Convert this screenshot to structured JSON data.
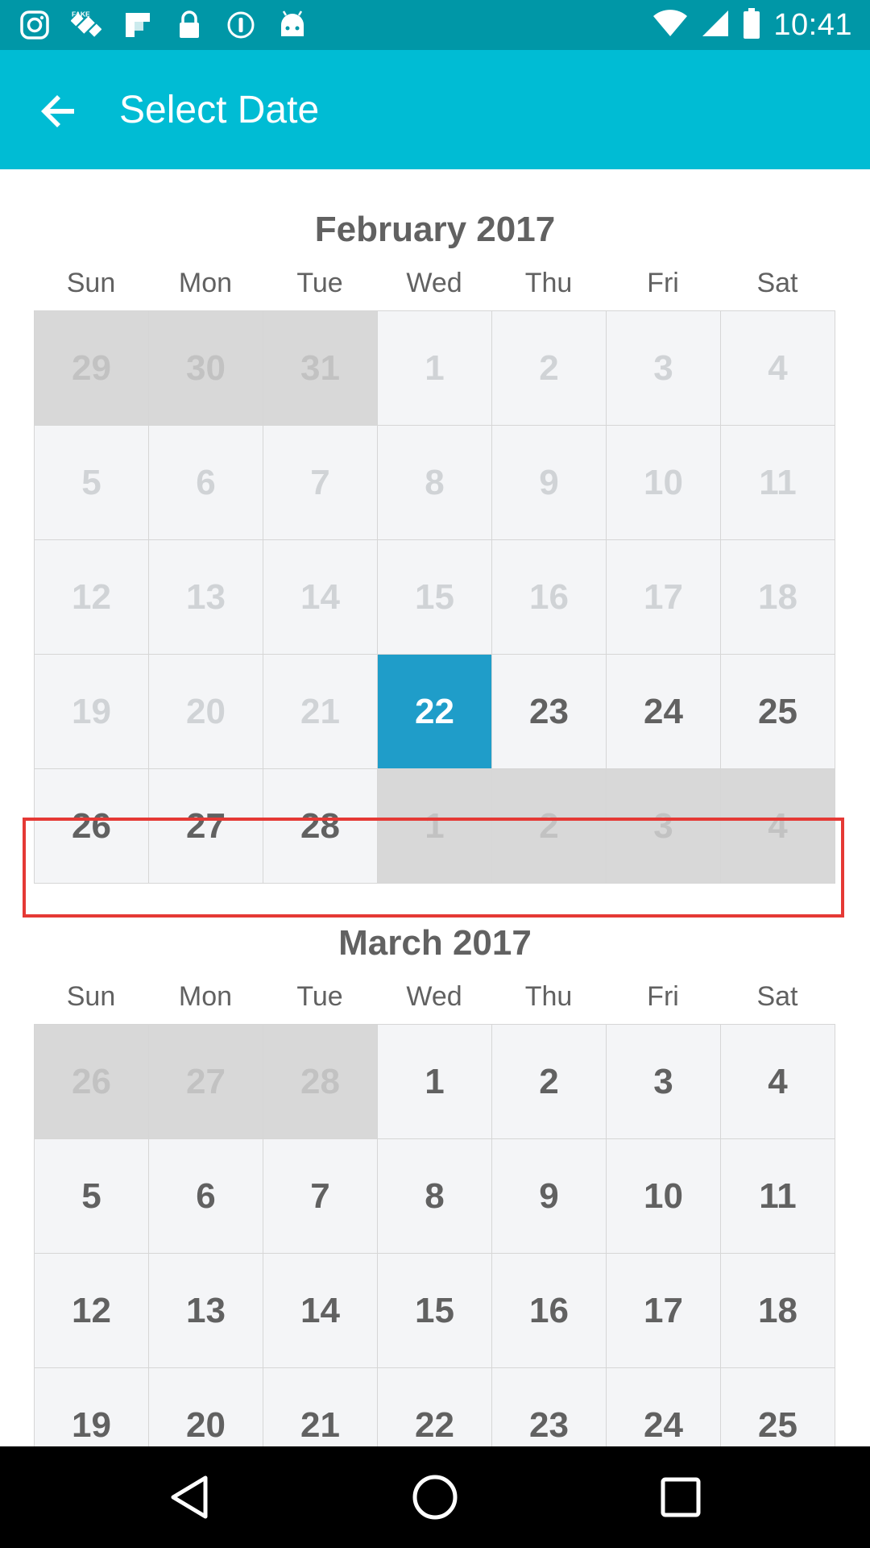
{
  "status_bar": {
    "time": "10:41",
    "icons": [
      "instagram-icon",
      "fake-gps-icon",
      "flipboard-icon",
      "lock-icon",
      "info-icon",
      "android-icon"
    ],
    "right_icons": [
      "wifi-icon",
      "signal-icon",
      "battery-icon"
    ]
  },
  "app_bar": {
    "title": "Select Date",
    "back_icon": "arrow-back-icon"
  },
  "weekdays": [
    "Sun",
    "Mon",
    "Tue",
    "Wed",
    "Thu",
    "Fri",
    "Sat"
  ],
  "months": [
    {
      "title": "February 2017",
      "weeks": [
        [
          {
            "day": "29",
            "state": "other"
          },
          {
            "day": "30",
            "state": "other"
          },
          {
            "day": "31",
            "state": "other"
          },
          {
            "day": "1",
            "state": "past"
          },
          {
            "day": "2",
            "state": "past"
          },
          {
            "day": "3",
            "state": "past"
          },
          {
            "day": "4",
            "state": "past"
          }
        ],
        [
          {
            "day": "5",
            "state": "past"
          },
          {
            "day": "6",
            "state": "past"
          },
          {
            "day": "7",
            "state": "past"
          },
          {
            "day": "8",
            "state": "past"
          },
          {
            "day": "9",
            "state": "past"
          },
          {
            "day": "10",
            "state": "past"
          },
          {
            "day": "11",
            "state": "past"
          }
        ],
        [
          {
            "day": "12",
            "state": "past"
          },
          {
            "day": "13",
            "state": "past"
          },
          {
            "day": "14",
            "state": "past"
          },
          {
            "day": "15",
            "state": "past"
          },
          {
            "day": "16",
            "state": "past"
          },
          {
            "day": "17",
            "state": "past"
          },
          {
            "day": "18",
            "state": "past"
          }
        ],
        [
          {
            "day": "19",
            "state": "past"
          },
          {
            "day": "20",
            "state": "past"
          },
          {
            "day": "21",
            "state": "past"
          },
          {
            "day": "22",
            "state": "selected"
          },
          {
            "day": "23",
            "state": "avail"
          },
          {
            "day": "24",
            "state": "avail"
          },
          {
            "day": "25",
            "state": "avail"
          }
        ],
        [
          {
            "day": "26",
            "state": "avail"
          },
          {
            "day": "27",
            "state": "avail"
          },
          {
            "day": "28",
            "state": "avail"
          },
          {
            "day": "1",
            "state": "other"
          },
          {
            "day": "2",
            "state": "other"
          },
          {
            "day": "3",
            "state": "other"
          },
          {
            "day": "4",
            "state": "other"
          }
        ]
      ]
    },
    {
      "title": "March 2017",
      "weeks": [
        [
          {
            "day": "26",
            "state": "other"
          },
          {
            "day": "27",
            "state": "other"
          },
          {
            "day": "28",
            "state": "other"
          },
          {
            "day": "1",
            "state": "avail"
          },
          {
            "day": "2",
            "state": "avail"
          },
          {
            "day": "3",
            "state": "avail"
          },
          {
            "day": "4",
            "state": "avail"
          }
        ],
        [
          {
            "day": "5",
            "state": "avail"
          },
          {
            "day": "6",
            "state": "avail"
          },
          {
            "day": "7",
            "state": "avail"
          },
          {
            "day": "8",
            "state": "avail"
          },
          {
            "day": "9",
            "state": "avail"
          },
          {
            "day": "10",
            "state": "avail"
          },
          {
            "day": "11",
            "state": "avail"
          }
        ],
        [
          {
            "day": "12",
            "state": "avail"
          },
          {
            "day": "13",
            "state": "avail"
          },
          {
            "day": "14",
            "state": "avail"
          },
          {
            "day": "15",
            "state": "avail"
          },
          {
            "day": "16",
            "state": "avail"
          },
          {
            "day": "17",
            "state": "avail"
          },
          {
            "day": "18",
            "state": "avail"
          }
        ],
        [
          {
            "day": "19",
            "state": "avail"
          },
          {
            "day": "20",
            "state": "avail"
          },
          {
            "day": "21",
            "state": "avail"
          },
          {
            "day": "22",
            "state": "avail"
          },
          {
            "day": "23",
            "state": "avail"
          },
          {
            "day": "24",
            "state": "avail"
          },
          {
            "day": "25",
            "state": "avail"
          }
        ]
      ]
    }
  ],
  "nav_bar": {
    "icons": [
      "nav-back-icon",
      "nav-home-icon",
      "nav-recents-icon"
    ]
  },
  "colors": {
    "status_bar": "#0097a7",
    "app_bar": "#00bcd4",
    "selected_day": "#1f9dc9",
    "highlight_box": "#e53935"
  }
}
